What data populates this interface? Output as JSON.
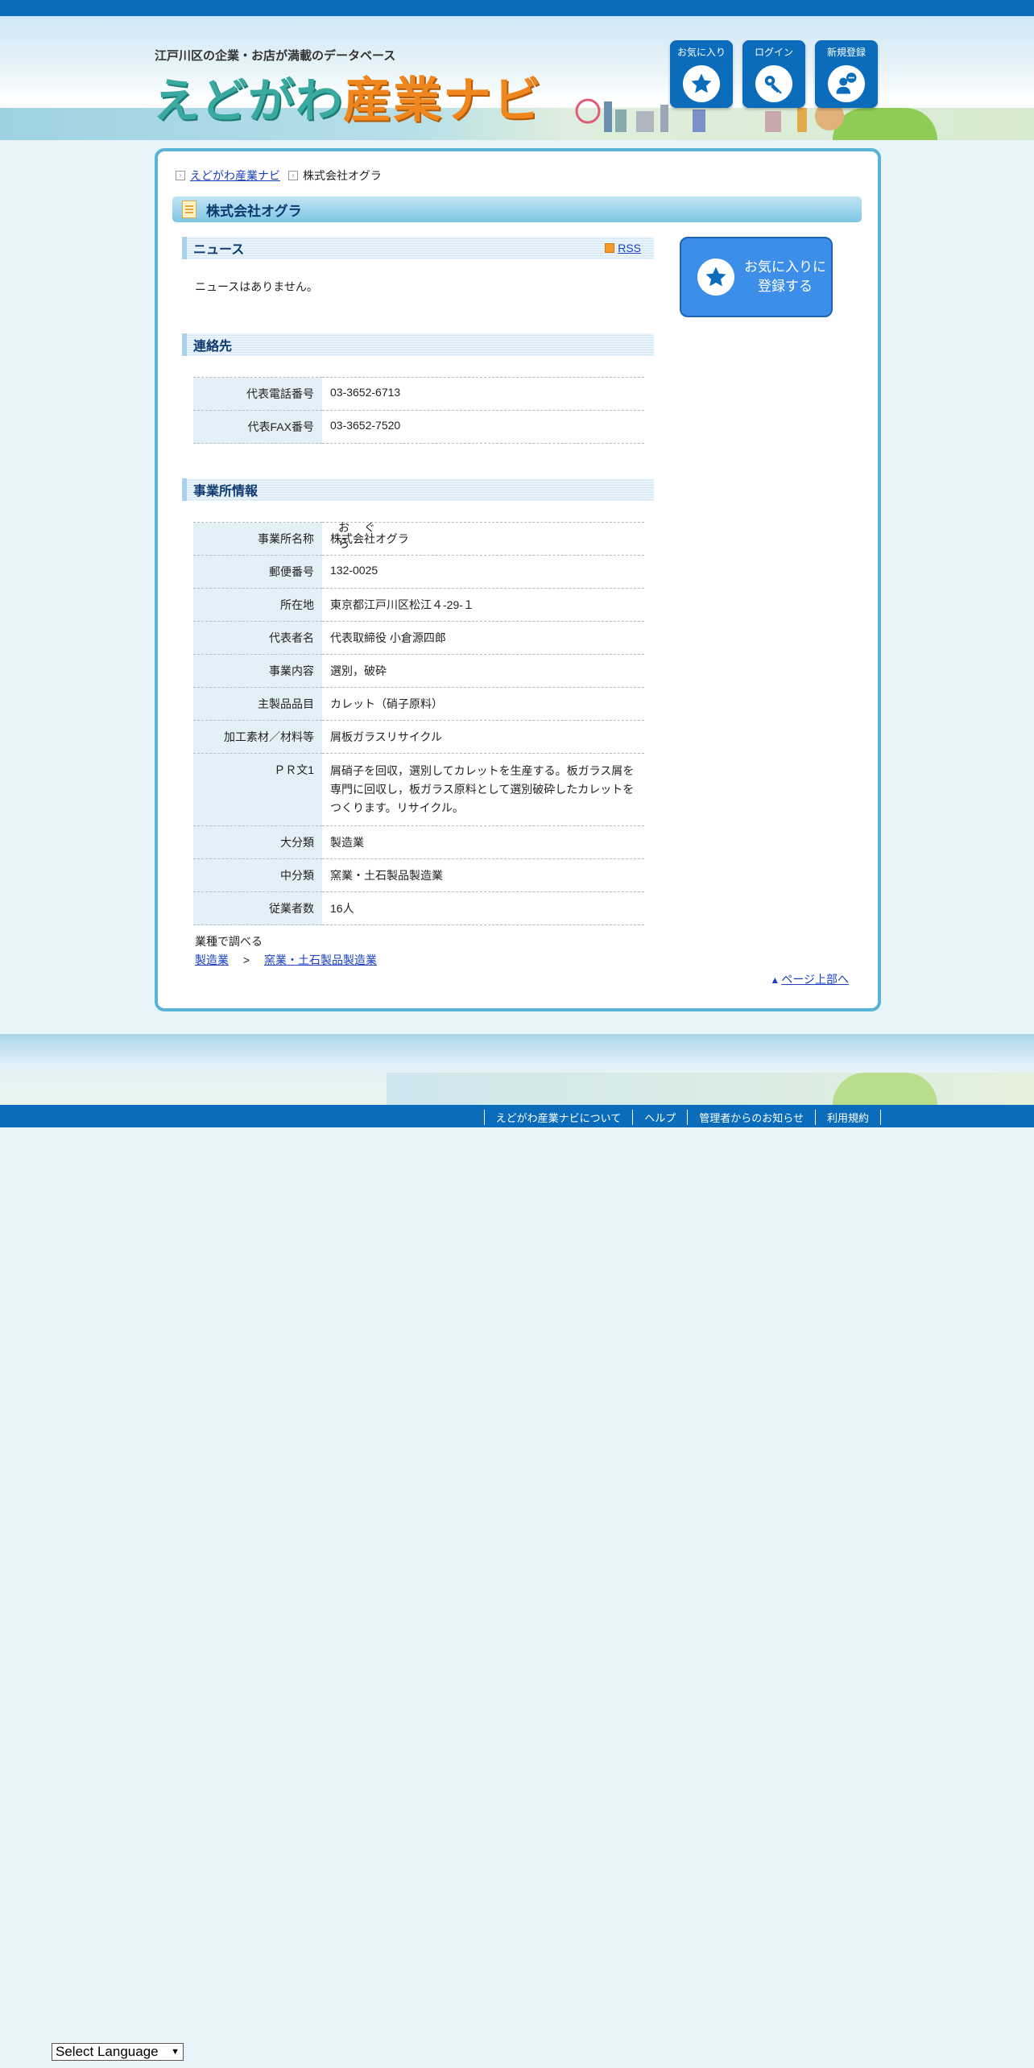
{
  "header": {
    "tagline": "江戸川区の企業・お店が満載のデータベース",
    "logo_part1": "えどがわ",
    "logo_part2": "産業ナビ",
    "buttons": [
      {
        "label": "お気に入り",
        "icon": "star-icon"
      },
      {
        "label": "ログイン",
        "icon": "key-icon"
      },
      {
        "label": "新規登録",
        "icon": "user-add-icon"
      }
    ]
  },
  "breadcrumb": {
    "home": "えどがわ産業ナビ",
    "current": "株式会社オグラ"
  },
  "page_title": "株式会社オグラ",
  "news": {
    "heading": "ニュース",
    "rss": "RSS",
    "empty": "ニュースはありません。"
  },
  "favorite_button": {
    "line1": "お気に入りに",
    "line2": "登録する"
  },
  "contact": {
    "heading": "連絡先",
    "rows": [
      {
        "key": "代表電話番号",
        "value": "03-3652-6713"
      },
      {
        "key": "代表FAX番号",
        "value": "03-3652-7520"
      }
    ]
  },
  "office": {
    "heading": "事業所情報",
    "name_key": "事業所名称",
    "name_ruby": "おぐら",
    "name_value": "株式会社オグラ",
    "rows": [
      {
        "key": "郵便番号",
        "value": "132-0025"
      },
      {
        "key": "所在地",
        "value": "東京都江戸川区松江４-29-１"
      },
      {
        "key": "代表者名",
        "value": "代表取締役 小倉源四郎"
      },
      {
        "key": "事業内容",
        "value": "選別，破砕"
      },
      {
        "key": "主製品品目",
        "value": "カレット（硝子原料）"
      },
      {
        "key": "加工素材／材料等",
        "value": "屑板ガラスリサイクル"
      },
      {
        "key": "ＰＲ文1",
        "value": "屑硝子を回収，選別してカレットを生産する。板ガラス屑を専門に回収し，板ガラス原料として選別破砕したカレットをつくります。リサイクル。"
      },
      {
        "key": "大分類",
        "value": "製造業"
      },
      {
        "key": "中分類",
        "value": "窯業・土石製品製造業"
      },
      {
        "key": "従業者数",
        "value": "16人"
      }
    ]
  },
  "industry": {
    "label": "業種で調べる",
    "link1": "製造業",
    "sep": ">",
    "link2": "窯業・土石製品製造業"
  },
  "page_top": "ページ上部へ",
  "footer_nav": [
    "えどがわ産業ナビについて",
    "ヘルプ",
    "管理者からのお知らせ",
    "利用規約"
  ],
  "language_select": "Select Language",
  "colors": {
    "primary": "#0a6cba",
    "border": "#5ab4d6",
    "accent": "#f0871e"
  }
}
